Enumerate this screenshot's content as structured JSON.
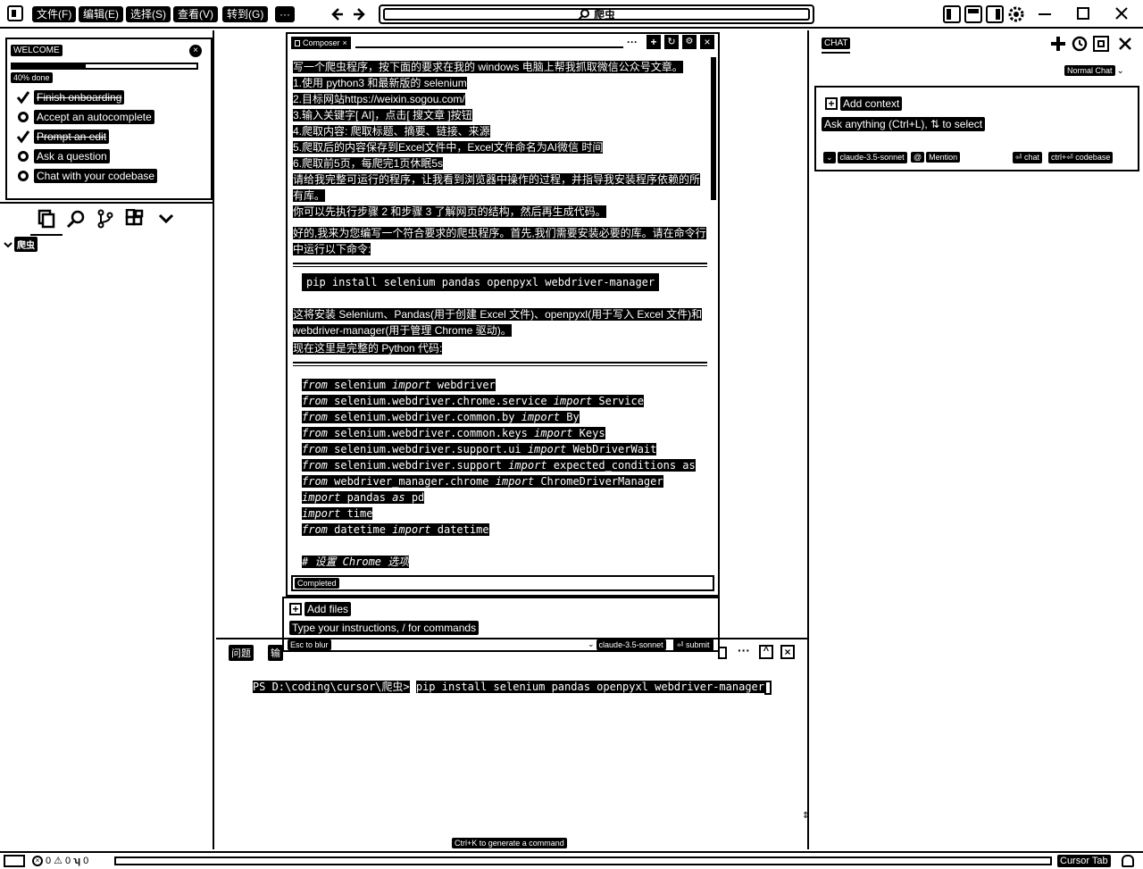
{
  "titlebar": {
    "menus": [
      "文件(F)",
      "编辑(E)",
      "选择(S)",
      "查看(V)",
      "转到(G)"
    ],
    "more": "···",
    "search": "爬虫"
  },
  "welcome": {
    "title": "WELCOME",
    "progress_label": "40% done",
    "progress": 0.4,
    "items": [
      {
        "label": "Finish onboarding",
        "done": true
      },
      {
        "label": "Accept an autocomplete",
        "done": false
      },
      {
        "label": "Prompt an edit",
        "done": true
      },
      {
        "label": "Ask a question",
        "done": false
      },
      {
        "label": "Chat with your codebase",
        "done": false
      }
    ]
  },
  "explorer": {
    "folder": "爬虫"
  },
  "composer": {
    "tab_label": "Composer",
    "user_message": [
      "写一个爬虫程序，按下面的要求在我的 windows 电脑上帮我抓取微信公众号文章。",
      "1.使用 python3 和最新版的 selenium",
      "2.目标网站https://weixin.sogou.com/",
      "3.输入关键字[ AI]，点击[ 搜文章 ]按钮",
      "4.爬取内容: 爬取标题、摘要、链接、来源",
      "5.爬取后的内容保存到Excel文件中，Excel文件命名为AI微信 时间",
      "6.爬取前5页，每爬完1页休眠5s",
      "请给我完整可运行的程序，让我看到浏览器中操作的过程，并指导我安装程序依赖的所有库。",
      "你可以先执行步骤 2 和步骤 3 了解网页的结构，然后再生成代码。"
    ],
    "reply_intro": "好的,我来为您编写一个符合要求的爬虫程序。首先,我们需要安装必要的库。请在命令行中运行以下命令:",
    "pip_command": "pip install selenium pandas openpyxl webdriver-manager",
    "reply_after_pip": "这将安装 Selenium、Pandas(用于创建 Excel 文件)、openpyxl(用于写入 Excel 文件)和 webdriver-manager(用于管理 Chrome 驱动)。",
    "reply_code_intro": "现在这里是完整的 Python 代码:",
    "code": [
      [
        "from",
        " selenium ",
        "import",
        " webdriver"
      ],
      [
        "from",
        " selenium.webdriver.chrome.service ",
        "import",
        " Service"
      ],
      [
        "from",
        " selenium.webdriver.common.by ",
        "import",
        " By"
      ],
      [
        "from",
        " selenium.webdriver.common.keys ",
        "import",
        " Keys"
      ],
      [
        "from",
        " selenium.webdriver.support.ui ",
        "import",
        " WebDriverWait"
      ],
      [
        "from",
        " selenium.webdriver.support ",
        "import",
        " expected_conditions as"
      ],
      [
        "from",
        " webdriver_manager.chrome ",
        "import",
        " ChromeDriverManager"
      ],
      [
        "import",
        " pandas ",
        "as",
        " pd"
      ],
      [
        "import",
        " time",
        "",
        ""
      ],
      [
        "from",
        " datetime ",
        "import",
        " datetime"
      ],
      [
        "",
        "",
        "",
        ""
      ],
      [
        "# 设置 Chrome 选项",
        "",
        "",
        ""
      ]
    ],
    "status": "Completed",
    "add_files": "Add files",
    "input_placeholder": "Type your instructions, / for commands",
    "esc_hint": "Esc to blur",
    "model": "claude-3.5-sonnet",
    "submit": "⏎ submit"
  },
  "terminal": {
    "tab_problems": "问题",
    "tab_output": "输",
    "prompt": "PS D:\\coding\\cursor\\爬虫>",
    "command": "pip install selenium pandas openpyxl webdriver-manager",
    "hint": "Ctrl+K to generate a command"
  },
  "chat": {
    "tab": "CHAT",
    "mode": "Normal Chat",
    "add_context": "Add context",
    "placeholder": "Ask anything (Ctrl+L), ⇅ to select",
    "model": "claude-3.5-sonnet",
    "mention": "Mention",
    "chat_btn": "⏎ chat",
    "codebase_btn": "ctrl+⏎ codebase"
  },
  "statusbar": {
    "errors": "0",
    "warnings": "0",
    "ports": "0",
    "cursor_tab": "Cursor Tab"
  }
}
